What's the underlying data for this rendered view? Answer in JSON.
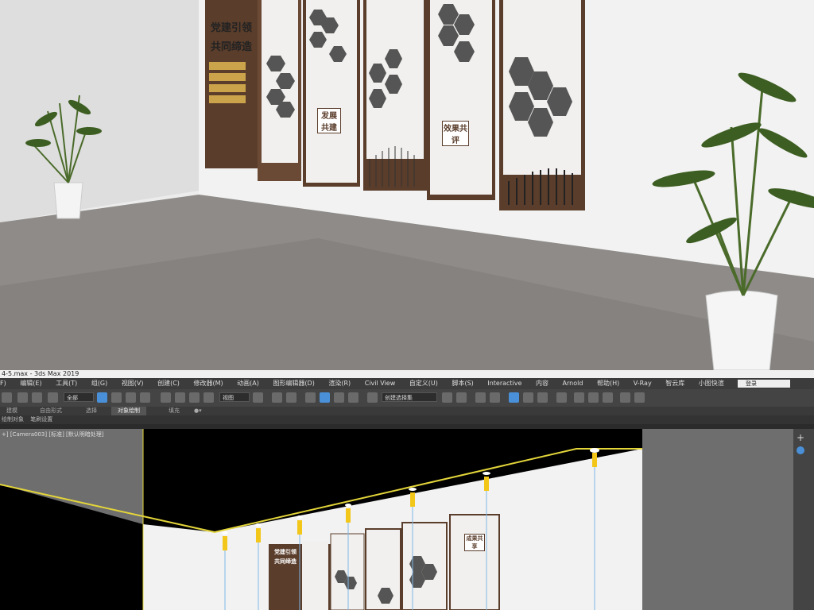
{
  "window": {
    "title": "4-5.max - 3ds Max 2019"
  },
  "menu": {
    "items": [
      "F)",
      "编辑(E)",
      "工具(T)",
      "组(G)",
      "视图(V)",
      "创建(C)",
      "修改器(M)",
      "动画(A)",
      "图形编辑器(D)",
      "渲染(R)",
      "Civil View",
      "自定义(U)",
      "脚本(S)",
      "Interactive",
      "内容",
      "Arnold",
      "帮助(H)",
      "V-Ray",
      "智云库",
      "小图快渲"
    ],
    "login": "登录"
  },
  "toolbar": {
    "filter": "全部",
    "view": "视图",
    "selset": "创建选择集"
  },
  "ribbon": {
    "tabs": [
      "建模",
      "自由形式",
      "选择",
      "对象绘制",
      "填充"
    ],
    "active": "对象绘制"
  },
  "ribbon2": {
    "items": [
      "绘制对象",
      "笔刷设置"
    ]
  },
  "viewport": {
    "label": "+] [Camera003] [标准] [默认明暗处理]"
  },
  "scene": {
    "panel_title_1": "党建引领",
    "panel_title_2": "共同缔造",
    "panel_title_3": "发展共建",
    "panel_title_4": "效果共评",
    "vp_title_1": "党建引领",
    "vp_title_2": "共同缔造",
    "vp_badge": "成果共享"
  },
  "colors": {
    "wood": "#5a3d2b",
    "panel": "#f1f0ee",
    "ui_dark": "#3c3c3c",
    "light_rope": "#f3c61a"
  }
}
